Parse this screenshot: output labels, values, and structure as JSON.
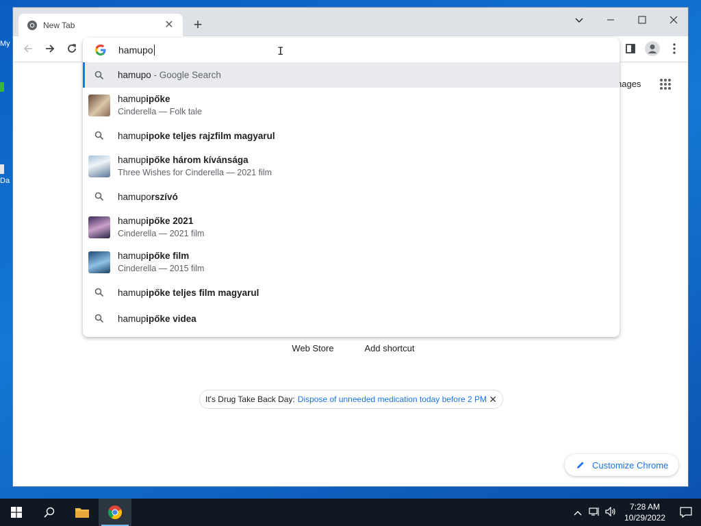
{
  "desktop": {
    "frag1": "My",
    "frag2": "Da"
  },
  "tab": {
    "title": "New Tab",
    "close": "✕"
  },
  "newtab": "+",
  "omnibox": {
    "value": "hamupo",
    "suggestions": [
      {
        "type": "search",
        "prefix": "hamupo",
        "bold": "",
        "suffix": " - Google Search",
        "selected": true
      },
      {
        "type": "entity",
        "prefix": "hamup",
        "bold": "i",
        "bold2": "pőke",
        "sub": "Cinderella — Folk tale",
        "thumb": "thumb-1"
      },
      {
        "type": "search",
        "prefix": "hamup",
        "bold": "ipoke teljes rajzfilm magyarul"
      },
      {
        "type": "entity",
        "prefix": "hamup",
        "bold": "ipőke három kívánsága",
        "sub": "Three Wishes for Cinderella — 2021 film",
        "thumb": "thumb-2"
      },
      {
        "type": "search",
        "prefix": "hamupo",
        "bold": "rszívó"
      },
      {
        "type": "entity",
        "prefix": "hamup",
        "bold": "ipőke 2021",
        "sub": "Cinderella — 2021 film",
        "thumb": "thumb-3"
      },
      {
        "type": "entity",
        "prefix": "hamup",
        "bold": "ipőke film",
        "sub": "Cinderella — 2015 film",
        "thumb": "thumb-4"
      },
      {
        "type": "search",
        "prefix": "hamup",
        "bold": "ipőke teljes film magyarul"
      },
      {
        "type": "search",
        "prefix": "hamup",
        "bold": "ipőke videa"
      }
    ]
  },
  "ntp": {
    "images_link": "nages",
    "tiles": [
      {
        "label": "Web Store"
      },
      {
        "label": "Add shortcut"
      }
    ],
    "promo": {
      "text": "It's Drug Take Back Day:",
      "link": "Dispose of unneeded medication today before 2 PM",
      "close": "✕"
    },
    "customize": "Customize Chrome"
  },
  "taskbar": {
    "time": "7:28 AM",
    "date": "10/29/2022"
  },
  "colors": {
    "accent": "#1a73e8",
    "taskbar": "#101923"
  }
}
